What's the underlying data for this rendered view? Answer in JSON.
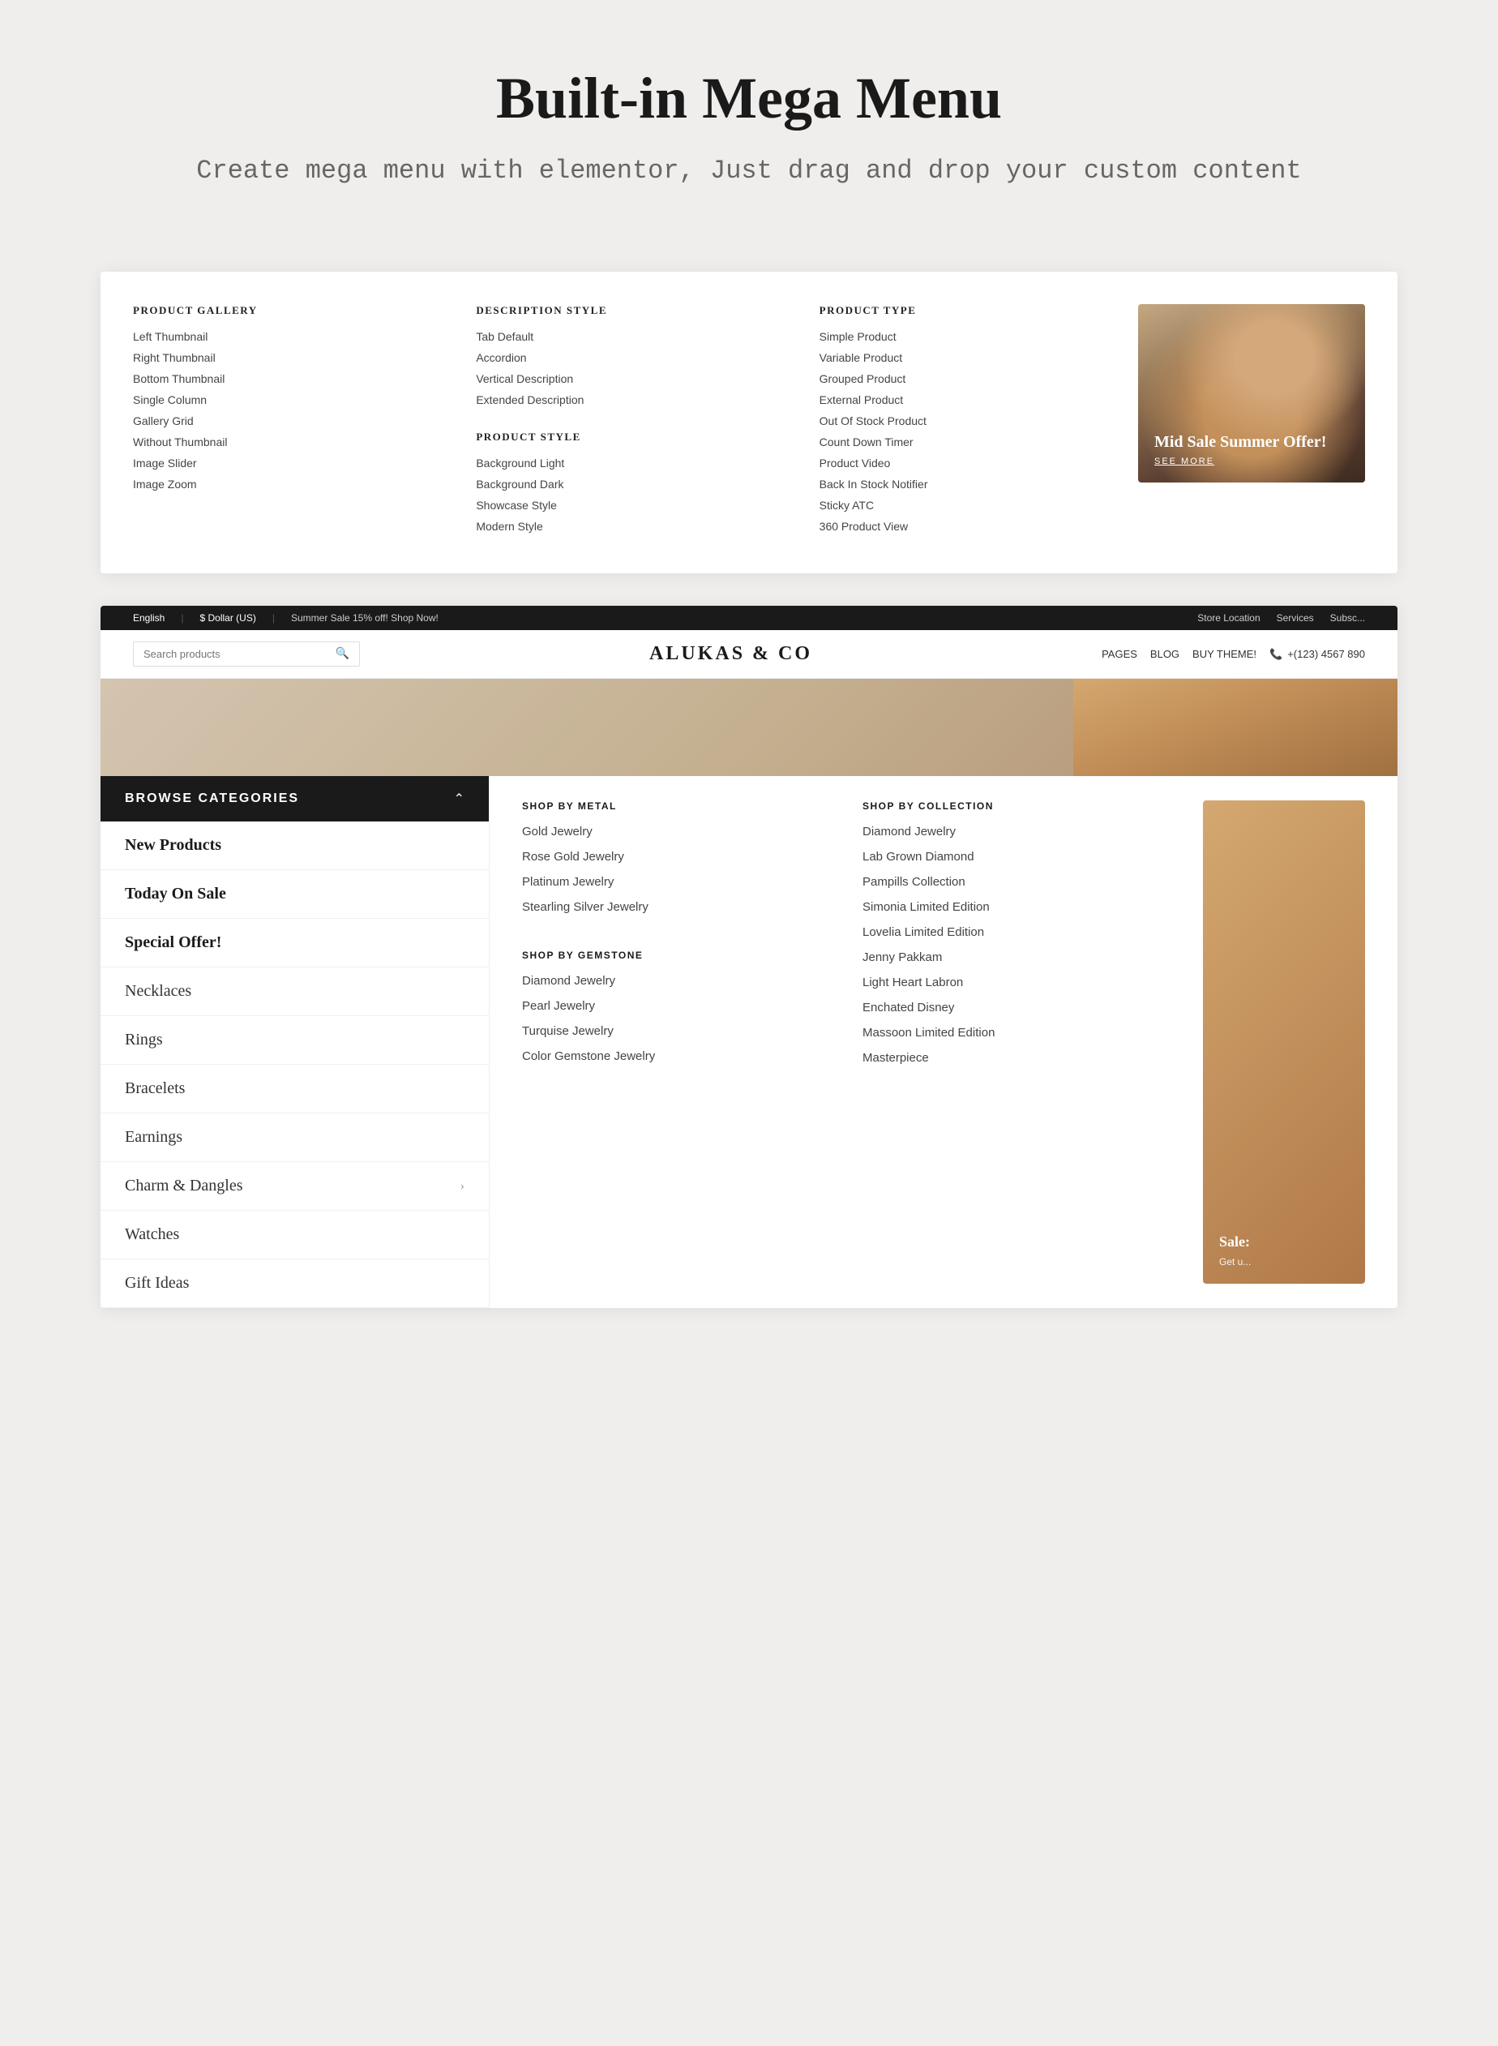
{
  "hero": {
    "title": "Built-in Mega Menu",
    "subtitle": "Create mega menu with elementor, Just drag and drop\nyour custom content"
  },
  "megaMenu1": {
    "columns": [
      {
        "header": "PRODUCT GALLERY",
        "items": [
          "Left Thumbnail",
          "Right Thumbnail",
          "Bottom Thumbnail",
          "Single Column",
          "Gallery Grid",
          "Without Thumbnail",
          "Image Slider",
          "Image Zoom"
        ]
      },
      {
        "header": "DESCRIPTION STYLE",
        "items": [
          "Tab Default",
          "Accordion",
          "Vertical Description",
          "Extended Description"
        ],
        "spacer": true,
        "header2": "PRODUCT STYLE",
        "items2": [
          "Background Light",
          "Background Dark",
          "Showcase Style",
          "Modern Style"
        ]
      },
      {
        "header": "PRODUCT TYPE",
        "items": [
          "Simple Product",
          "Variable Product",
          "Grouped Product",
          "External Product",
          "Out Of Stock Product",
          "Count Down Timer",
          "Product Video",
          "Back In Stock Notifier",
          "Sticky ATC",
          "360 Product View"
        ]
      }
    ],
    "image": {
      "sale_title": "Mid Sale\nSummer Offer!",
      "sale_link": "SEE MORE"
    }
  },
  "topbar": {
    "english": "English",
    "currency": "$ Dollar (US)",
    "promo": "Summer Sale 15% off! Shop Now!",
    "store_location": "Store Location",
    "services": "Services",
    "subscribe": "Subsc..."
  },
  "navbar": {
    "search_placeholder": "Search products",
    "brand": "ALUKAS & CO",
    "nav_items": [
      "PAGES",
      "BLOG",
      "BUY THEME!"
    ],
    "phone": "+(123) 4567 890"
  },
  "sidebar": {
    "header": "BROWSE CATEGORIES",
    "items": [
      {
        "label": "New Products",
        "bold": true,
        "arrow": false
      },
      {
        "label": "Today On Sale",
        "bold": true,
        "arrow": false
      },
      {
        "label": "Special Offer!",
        "bold": true,
        "arrow": false
      },
      {
        "label": "Necklaces",
        "bold": false,
        "arrow": false
      },
      {
        "label": "Rings",
        "bold": false,
        "arrow": false
      },
      {
        "label": "Bracelets",
        "bold": false,
        "arrow": false
      },
      {
        "label": "Earnings",
        "bold": false,
        "arrow": false
      },
      {
        "label": "Charm & Dangles",
        "bold": false,
        "arrow": true
      },
      {
        "label": "Watches",
        "bold": false,
        "arrow": false
      },
      {
        "label": "Gift Ideas",
        "bold": false,
        "arrow": false
      }
    ]
  },
  "dropdown": {
    "col1": {
      "header": "SHOP BY METAL",
      "items": [
        "Gold Jewelry",
        "Rose Gold Jewelry",
        "Platinum Jewelry",
        "Stearling Silver Jewelry"
      ]
    },
    "col2": {
      "header": "SHOP BY GEMSTONE",
      "items": [
        "Diamond Jewelry",
        "Pearl Jewelry",
        "Turquise Jewelry",
        "Color Gemstone Jewelry"
      ]
    },
    "col3": {
      "header": "SHOP BY COLLECTION",
      "items": [
        "Diamond Jewelry",
        "Lab Grown Diamond",
        "Pampills Collection",
        "Simonia Limited Edition",
        "Lovelia Limited Edition",
        "Jenny Pakkam",
        "Light Heart Labron",
        "Enchated Disney",
        "Massoon Limited Edition",
        "Masterpiece"
      ]
    },
    "sale": {
      "title": "Sale:",
      "subtitle": "Get u..."
    }
  }
}
